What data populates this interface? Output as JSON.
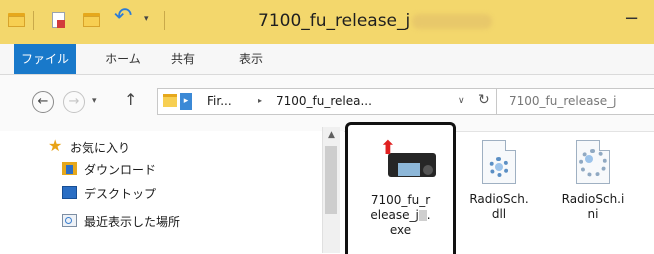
{
  "window": {
    "title": "7100_fu_release_j",
    "minimize_glyph": "−"
  },
  "quick_access": {
    "undo_icon": "undo-arrow-icon",
    "dropdown_glyph": "▾"
  },
  "ribbon": {
    "tabs": [
      {
        "label": "ファイル",
        "active": true
      },
      {
        "label": "ホーム"
      },
      {
        "label": "共有"
      },
      {
        "label": "表示"
      }
    ],
    "active_color": "#1979ca"
  },
  "address_bar": {
    "back_glyph": "←",
    "forward_glyph": "→",
    "recent_glyph": "▾",
    "up_glyph": "↑",
    "crumbs": [
      "Fir...",
      "7100_fu_relea..."
    ],
    "crumb_separator": "▸",
    "dropdown_glyph": "∨",
    "refresh_glyph": "↻",
    "search_placeholder": "7100_fu_release_j"
  },
  "nav_pane": {
    "items": [
      {
        "label": "お気に入り",
        "icon": "star-icon"
      },
      {
        "label": "ダウンロード",
        "icon": "downloads-folder-icon"
      },
      {
        "label": "デスクトップ",
        "icon": "desktop-icon"
      },
      {
        "label": "最近表示した場所",
        "icon": "recent-places-icon"
      }
    ],
    "scroll_up_glyph": "▲"
  },
  "files": [
    {
      "name_lines": [
        "7100_fu_r",
        "elease_j",
        "."
      ],
      "tail": "exe",
      "icon": "radio-installer-icon",
      "selected": true
    },
    {
      "name_lines": [
        "RadioSch.",
        "dll"
      ],
      "icon": "dll-gear-icon"
    },
    {
      "name_lines": [
        "RadioSch.i",
        "ni"
      ],
      "icon": "ini-gear-icon"
    }
  ],
  "icons": {
    "star": "★",
    "update_arrow": "⬆"
  }
}
